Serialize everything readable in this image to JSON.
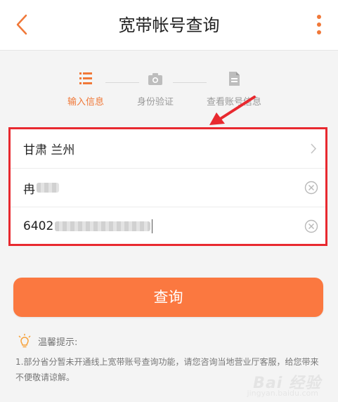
{
  "header": {
    "title": "宽带帐号查询"
  },
  "steps": [
    {
      "label": "输入信息",
      "state": "active"
    },
    {
      "label": "身份验证",
      "state": "inactive"
    },
    {
      "label": "查看账号信息",
      "state": "inactive"
    }
  ],
  "form": {
    "region_value": "甘肃  兰州",
    "name_prefix": "冉",
    "id_prefix": "6402"
  },
  "query_button": {
    "label": "查询"
  },
  "tips": {
    "title": "温馨提示:",
    "text": "1.部分省分暂未开通线上宽带账号查询功能，请您咨询当地营业厅客服，给您带来不便敬请谅解。"
  },
  "watermark": {
    "text": "Bai 经验",
    "sub": "jingyan.baidu.com"
  },
  "colors": {
    "accent": "#fb7840",
    "active_step": "#f07838",
    "highlight_border": "#e8292f",
    "arrow": "#e8292f"
  }
}
